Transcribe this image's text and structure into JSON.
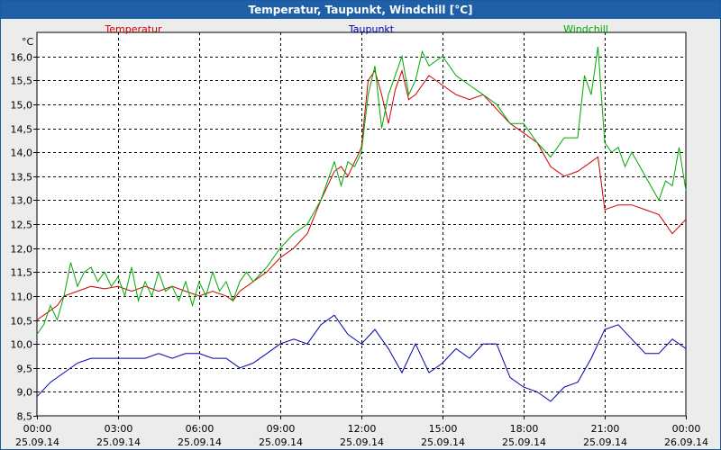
{
  "title": "Temperatur, Taupunkt, Windchill [°C]",
  "colors": {
    "titlebar": "#1e5fa8",
    "temperatur": "#cc0000",
    "taupunkt": "#0000aa",
    "windchill": "#00aa00"
  },
  "chart_data": {
    "type": "line",
    "title": "Temperatur, Taupunkt, Windchill [°C]",
    "ylabel": "°C",
    "ylim": [
      8.5,
      16.5
    ],
    "xlim": [
      0,
      24
    ],
    "grid": true,
    "legend_placement": "top",
    "yticks": [
      "8,5",
      "9,0",
      "9,5",
      "10,0",
      "10,5",
      "11,0",
      "11,5",
      "12,0",
      "12,5",
      "13,0",
      "13,5",
      "14,0",
      "14,5",
      "15,0",
      "15,5",
      "16,0"
    ],
    "ytick_values": [
      8.5,
      9.0,
      9.5,
      10.0,
      10.5,
      11.0,
      11.5,
      12.0,
      12.5,
      13.0,
      13.5,
      14.0,
      14.5,
      15.0,
      15.5,
      16.0
    ],
    "xticks": [
      {
        "time": "00:00",
        "date": "25.09.14"
      },
      {
        "time": "03:00",
        "date": "25.09.14"
      },
      {
        "time": "06:00",
        "date": "25.09.14"
      },
      {
        "time": "09:00",
        "date": "25.09.14"
      },
      {
        "time": "12:00",
        "date": "25.09.14"
      },
      {
        "time": "15:00",
        "date": "25.09.14"
      },
      {
        "time": "18:00",
        "date": "25.09.14"
      },
      {
        "time": "21:00",
        "date": "25.09.14"
      },
      {
        "time": "00:00",
        "date": "26.09.14"
      }
    ],
    "xtick_values": [
      0,
      3,
      6,
      9,
      12,
      15,
      18,
      21,
      24
    ],
    "series": [
      {
        "name": "Temperatur",
        "color": "#cc0000",
        "x": [
          0,
          0.25,
          0.5,
          0.75,
          1,
          1.5,
          2,
          2.5,
          3,
          3.5,
          4,
          4.5,
          5,
          5.5,
          6,
          6.5,
          7,
          7.25,
          7.5,
          8,
          8.5,
          9,
          9.5,
          10,
          10.5,
          11,
          11.25,
          11.5,
          11.75,
          12,
          12.25,
          12.5,
          12.75,
          13,
          13.25,
          13.5,
          13.75,
          14,
          14.5,
          15,
          15.5,
          16,
          16.5,
          17,
          17.5,
          18,
          18.5,
          19,
          19.5,
          20,
          20.5,
          20.75,
          21,
          21.5,
          22,
          22.5,
          23,
          23.5,
          24
        ],
        "y": [
          10.5,
          10.6,
          10.7,
          10.8,
          11.0,
          11.1,
          11.2,
          11.15,
          11.2,
          11.1,
          11.2,
          11.1,
          11.2,
          11.1,
          11.0,
          11.1,
          11.0,
          10.9,
          11.1,
          11.3,
          11.5,
          11.8,
          12.0,
          12.3,
          13.0,
          13.6,
          13.7,
          13.5,
          13.8,
          14.1,
          15.5,
          15.7,
          15.2,
          14.6,
          15.3,
          15.7,
          15.1,
          15.2,
          15.6,
          15.4,
          15.2,
          15.1,
          15.2,
          14.9,
          14.6,
          14.4,
          14.2,
          13.7,
          13.5,
          13.6,
          13.8,
          13.9,
          12.8,
          12.9,
          12.9,
          12.8,
          12.7,
          12.3,
          12.6
        ]
      },
      {
        "name": "Taupunkt",
        "color": "#0000aa",
        "x": [
          0,
          0.5,
          1,
          1.5,
          2,
          3,
          4,
          4.5,
          5,
          5.5,
          6,
          6.5,
          7,
          7.5,
          8,
          8.5,
          9,
          9.5,
          10,
          10.5,
          11,
          11.5,
          12,
          12.5,
          13,
          13.5,
          14,
          14.5,
          15,
          15.5,
          16,
          16.5,
          17,
          17.5,
          18,
          18.5,
          19,
          19.5,
          20,
          20.5,
          21,
          21.5,
          22,
          22.5,
          23,
          23.5,
          24
        ],
        "y": [
          8.9,
          9.2,
          9.4,
          9.6,
          9.7,
          9.7,
          9.7,
          9.8,
          9.7,
          9.8,
          9.8,
          9.7,
          9.7,
          9.5,
          9.6,
          9.8,
          10.0,
          10.1,
          10.0,
          10.4,
          10.6,
          10.2,
          10.0,
          10.3,
          9.9,
          9.4,
          10.0,
          9.4,
          9.6,
          9.9,
          9.7,
          10.0,
          10.0,
          9.3,
          9.1,
          9.0,
          8.8,
          9.1,
          9.2,
          9.7,
          10.3,
          10.4,
          10.1,
          9.8,
          9.8,
          10.1,
          9.9
        ]
      },
      {
        "name": "Windchill",
        "color": "#00aa00",
        "x": [
          0,
          0.25,
          0.5,
          0.75,
          1,
          1.25,
          1.5,
          1.75,
          2,
          2.25,
          2.5,
          2.75,
          3,
          3.25,
          3.5,
          3.75,
          4,
          4.25,
          4.5,
          4.75,
          5,
          5.25,
          5.5,
          5.75,
          6,
          6.25,
          6.5,
          6.75,
          7,
          7.25,
          7.5,
          7.75,
          8,
          8.5,
          9,
          9.5,
          10,
          10.5,
          11,
          11.25,
          11.5,
          11.75,
          12,
          12.25,
          12.5,
          12.75,
          13,
          13.25,
          13.5,
          13.75,
          14,
          14.25,
          14.5,
          15,
          15.5,
          16,
          16.5,
          17,
          17.5,
          18,
          18.5,
          19,
          19.5,
          20,
          20.25,
          20.5,
          20.75,
          21,
          21.25,
          21.5,
          21.75,
          22,
          22.5,
          23,
          23.25,
          23.5,
          23.75,
          24
        ],
        "y": [
          10.2,
          10.4,
          10.8,
          10.5,
          11.0,
          11.7,
          11.2,
          11.5,
          11.6,
          11.3,
          11.5,
          11.2,
          11.4,
          11.0,
          11.6,
          10.9,
          11.3,
          11.0,
          11.5,
          11.1,
          11.2,
          10.9,
          11.3,
          10.8,
          11.3,
          11.0,
          11.5,
          11.1,
          11.3,
          10.9,
          11.3,
          11.5,
          11.3,
          11.6,
          12.0,
          12.3,
          12.5,
          13.0,
          13.8,
          13.3,
          13.8,
          13.7,
          14.0,
          15.2,
          15.8,
          14.5,
          15.2,
          15.6,
          16.0,
          15.2,
          15.5,
          16.1,
          15.8,
          16.0,
          15.6,
          15.4,
          15.2,
          15.0,
          14.6,
          14.6,
          14.2,
          13.9,
          14.3,
          14.3,
          15.6,
          15.2,
          16.2,
          14.2,
          14.0,
          14.1,
          13.7,
          14.0,
          13.5,
          13.0,
          13.4,
          13.3,
          14.1,
          13.2
        ]
      }
    ]
  }
}
